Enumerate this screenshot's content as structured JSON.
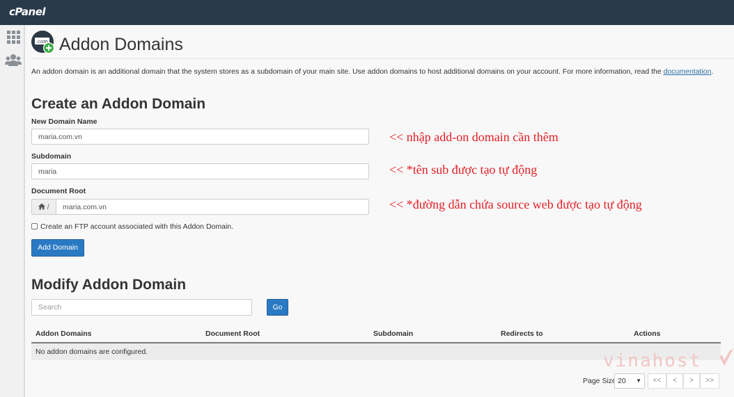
{
  "app": {
    "logo": "cPanel"
  },
  "sidebar": {
    "icons": [
      "grid-icon",
      "users-icon"
    ]
  },
  "header": {
    "title": "Addon Domains",
    "icon": "addon-domain-icon",
    "icon_text": ".com"
  },
  "description": {
    "text": "An addon domain is an additional domain that the system stores as a subdomain of your main site. Use addon domains to host additional domains on your account. For more information, read the ",
    "link": "documentation",
    "suffix": "."
  },
  "create": {
    "title": "Create an Addon Domain",
    "new_domain": {
      "label": "New Domain Name",
      "value": "maria.com.vn"
    },
    "subdomain": {
      "label": "Subdomain",
      "value": "maria"
    },
    "document_root": {
      "label": "Document Root",
      "prefix": "/",
      "value": "maria.com.vn"
    },
    "ftp_checkbox": {
      "label": "Create an FTP account associated with this Addon Domain.",
      "checked": false
    },
    "submit_label": "Add Domain"
  },
  "annotations": {
    "new_domain": "<< nhập add-on domain cần thêm",
    "subdomain": "<< *tên sub được tạo tự động",
    "document_root": "<< *đường dẫn chứa source web được tạo tự động"
  },
  "modify": {
    "title": "Modify Addon Domain",
    "search_placeholder": "Search",
    "go_label": "Go",
    "columns": [
      "Addon Domains",
      "Document Root",
      "Subdomain",
      "Redirects to",
      "Actions"
    ],
    "empty_message": "No addon domains are configured."
  },
  "pagination": {
    "page_size_label": "Page Size",
    "page_size": "20",
    "buttons": [
      "<<",
      "<",
      ">",
      ">>"
    ]
  },
  "watermark": "vinahost",
  "colors": {
    "topbar": "#293a4a",
    "primary": "#2a7ac3",
    "annotation": "#e31e24",
    "link": "#2b6ea5"
  }
}
